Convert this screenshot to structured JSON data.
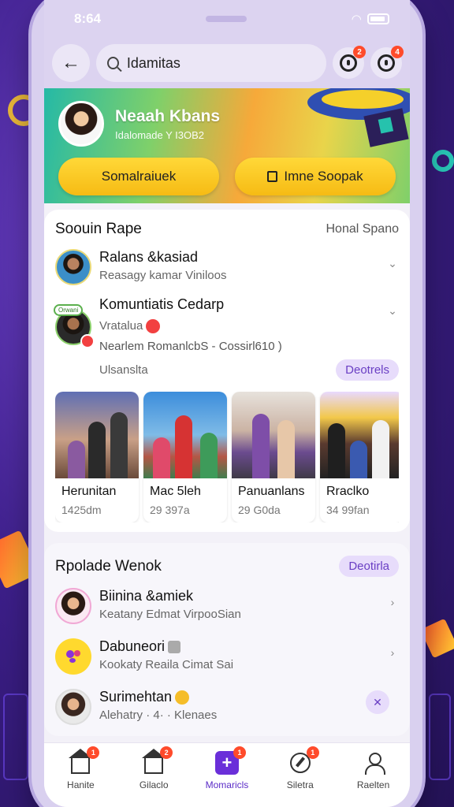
{
  "status_bar": {
    "time": "8:64"
  },
  "topbar": {
    "search_value": "Idamitas",
    "badge_1": "2",
    "badge_2": "4"
  },
  "hero": {
    "name": "Neaah Kbans",
    "subtitle": "Idalomade Y I3OB2",
    "button_1": "Somalraiuek",
    "button_2": "Imne Soopak"
  },
  "section_1": {
    "title": "Soouin Rape",
    "link": "Honal Spano",
    "items": [
      {
        "title": "Ralans &kasiad",
        "sub": "Reasagy kamar Viniloos"
      },
      {
        "title": "Komuntiatis Cedarp",
        "line2": "Vratalua",
        "line3": "Nearlem RomanlcbS - Cossirl610 )",
        "line4": "Ulsanslta",
        "action": "Deotrels",
        "bubble": "Orwani"
      }
    ],
    "photos": [
      {
        "label": "Herunitan",
        "meta": "1425dm"
      },
      {
        "label": "Mac 5leh",
        "meta": "29 397a"
      },
      {
        "label": "Panuanlans",
        "meta": "29 G0da"
      },
      {
        "label": "Rraclko",
        "meta": "34 99fan"
      }
    ]
  },
  "section_2": {
    "title": "Rpolade Wenok",
    "action": "Deotirla",
    "items": [
      {
        "title": "Biinina &amiek",
        "sub": "Keatany Edmat VirpooSian"
      },
      {
        "title": "Dabuneori",
        "sub": "Kookaty Reaila Cimat Sai"
      },
      {
        "title": "Surimehtan",
        "sub": "Alehatry · 4· · Klenaes"
      }
    ]
  },
  "nav": {
    "items": [
      {
        "label": "Hanite",
        "badge": "1"
      },
      {
        "label": "Gilaclo",
        "badge": "2"
      },
      {
        "label": "Momaricls",
        "badge": "1"
      },
      {
        "label": "Siletra",
        "badge": "1"
      },
      {
        "label": "Raelten"
      }
    ]
  },
  "colors": {
    "accent": "#6a2fd9",
    "badge": "#ff4b2b",
    "button": "#f6bb14"
  }
}
